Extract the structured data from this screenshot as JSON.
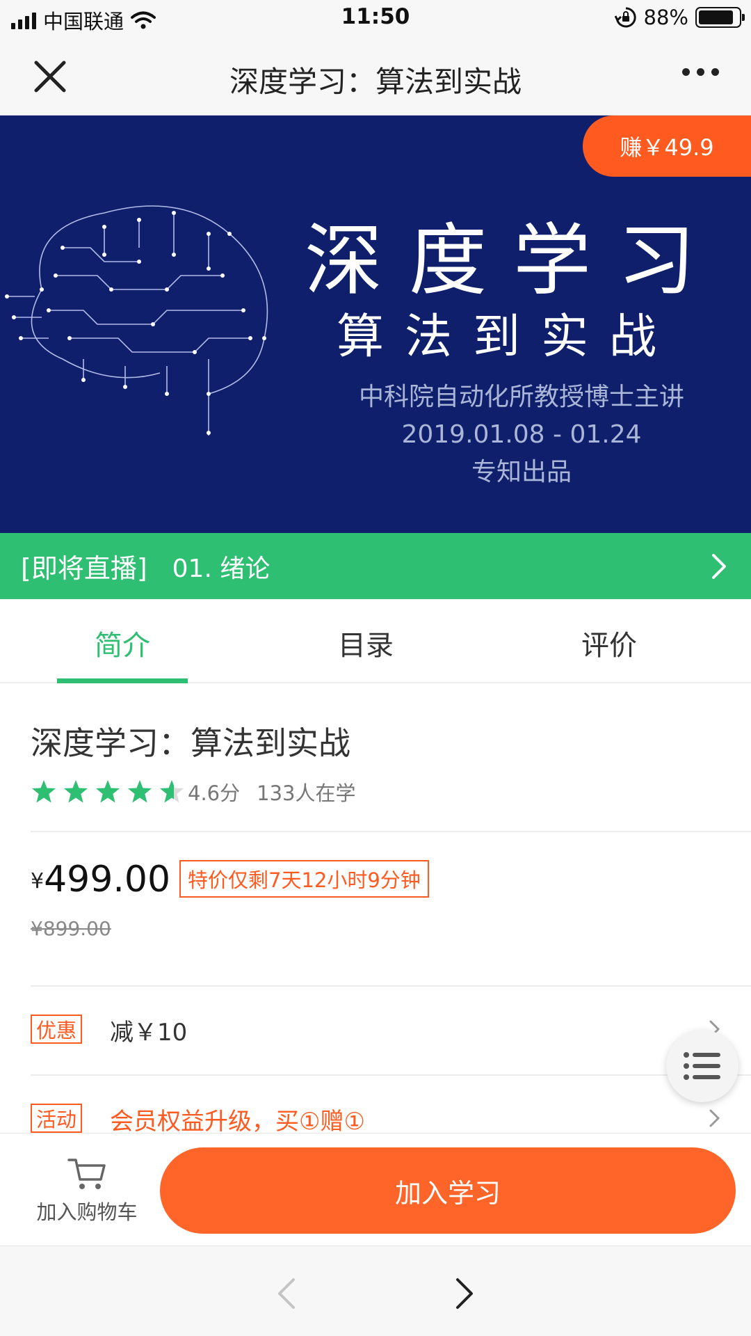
{
  "status_bar": {
    "carrier": "中国联通",
    "time": "11:50",
    "battery": "88%",
    "battery_level": 0.88,
    "icons": [
      "signal-icon",
      "wifi-icon",
      "rotation-lock-icon",
      "battery-icon"
    ]
  },
  "nav": {
    "title": "深度学习：算法到实战",
    "close_icon": "close-icon",
    "more_icon": "more-icon"
  },
  "banner": {
    "earn_label": "赚￥49.9",
    "title": "深度学习",
    "subtitle": "算法到实战",
    "lecturer": "中科院自动化所教授博士主讲",
    "dates": "2019.01.08 - 01.24",
    "producer": "专知出品",
    "background_color": "#0f1f6b",
    "illustration": "circuit-brain-illustration"
  },
  "live": {
    "tag": "[即将直播]",
    "lesson": "01. 绪论",
    "accent": "#2ebf72"
  },
  "tabs": [
    {
      "label": "简介",
      "active": true
    },
    {
      "label": "目录",
      "active": false
    },
    {
      "label": "评价",
      "active": false
    }
  ],
  "course": {
    "title": "深度学习：算法到实战",
    "rating_value": 4.6,
    "rating": "4.6分",
    "learners": "133人在学"
  },
  "pricing": {
    "currency": "¥",
    "price": "499.00",
    "countdown": "特价仅剩7天12小时9分钟",
    "original_price": "¥899.00"
  },
  "promos": [
    {
      "tag": "优惠",
      "text": "减￥10"
    },
    {
      "tag": "活动",
      "text": "会员权益升级，买①赠①"
    }
  ],
  "actions": {
    "cart_label": "加入购物车",
    "join_label": "加入学习",
    "accent": "#ff6429"
  },
  "browser": {
    "back_icon": "back-arrow-icon",
    "forward_icon": "forward-arrow-icon"
  },
  "fab": {
    "icon": "list-icon"
  }
}
